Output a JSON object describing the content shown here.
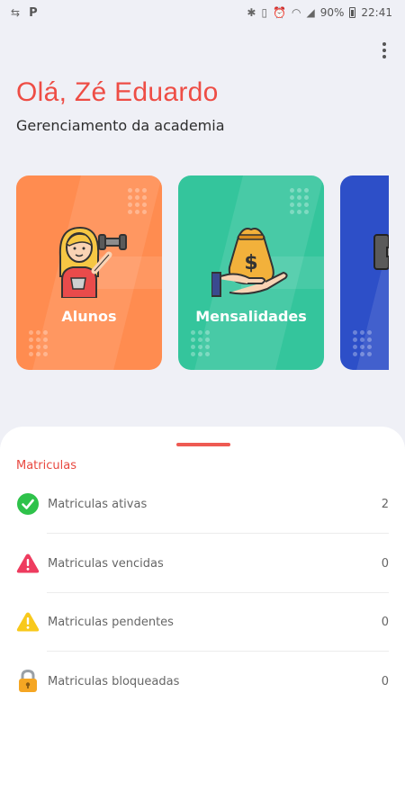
{
  "status_bar": {
    "p_label": "P",
    "battery": "90%",
    "time": "22:41"
  },
  "header": {
    "greeting": "Olá, Zé Eduardo",
    "subtitle": "Gerenciamento da academia"
  },
  "cards": [
    {
      "label": "Alunos",
      "color": "#ff8c50",
      "icon": "student-with-dumbbell-icon"
    },
    {
      "label": "Mensalidades",
      "color": "#34c59c",
      "icon": "money-bag-hand-icon"
    },
    {
      "label": "",
      "color": "#2d4fc8",
      "icon": "dumbbell-icon"
    }
  ],
  "matriculas": {
    "title": "Matriculas",
    "items": [
      {
        "label": "Matriculas ativas",
        "count": "2",
        "icon": "check-circle-icon",
        "color": "#2ec24a"
      },
      {
        "label": "Matriculas vencidas",
        "count": "0",
        "icon": "warning-triangle-red-icon",
        "color": "#ee3c5f"
      },
      {
        "label": "Matriculas pendentes",
        "count": "0",
        "icon": "warning-triangle-yellow-icon",
        "color": "#f8c91c"
      },
      {
        "label": "Matriculas bloqueadas",
        "count": "0",
        "icon": "padlock-icon",
        "color": "#f5a623"
      }
    ]
  },
  "colors": {
    "accent_red": "#ee4d45",
    "background": "#eff0f6"
  }
}
